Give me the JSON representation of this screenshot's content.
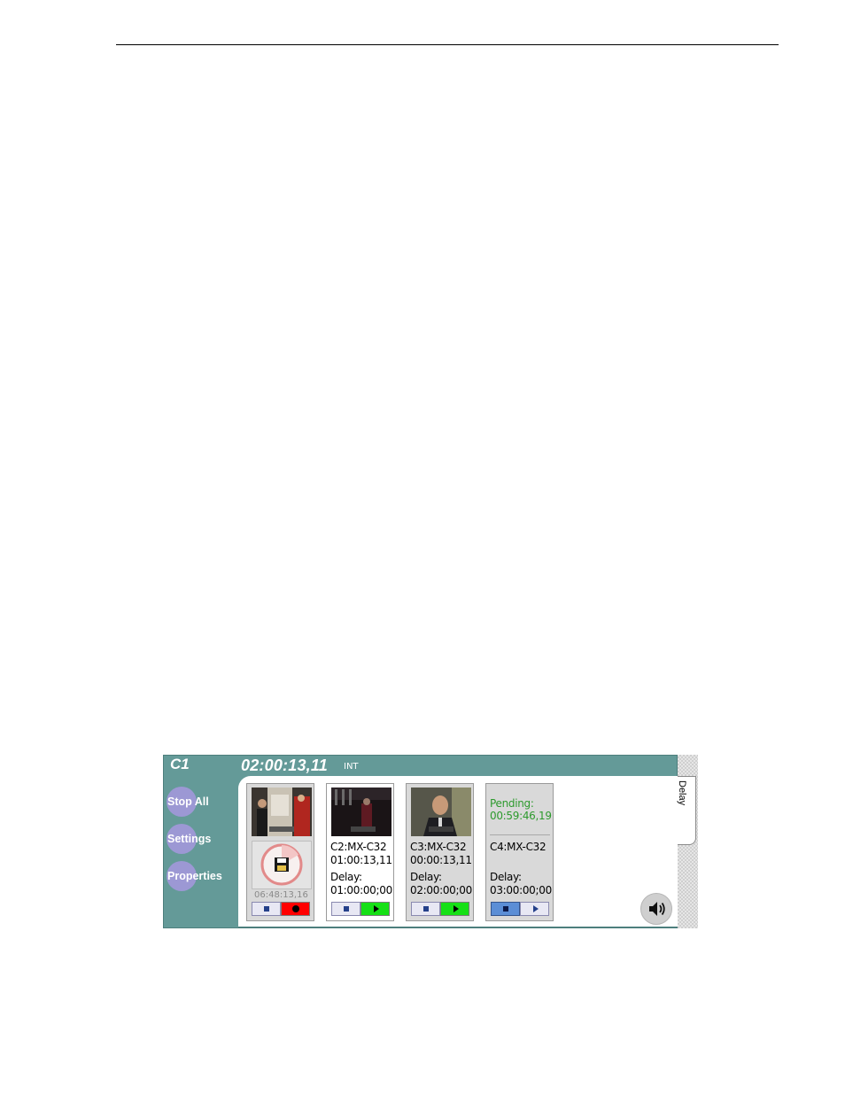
{
  "panel": {
    "channel_name": "C1",
    "timecode": "02:00:13,11",
    "source": "INT"
  },
  "sidebar": {
    "buttons": [
      {
        "label": "Stop All"
      },
      {
        "label": "Settings"
      },
      {
        "label": "Properties"
      }
    ]
  },
  "tab": {
    "label": "Delay"
  },
  "channels": [
    {
      "record_timecode": "06:48:13,16"
    },
    {
      "name": "C2:MX-C32",
      "timecode": "01:00:13,11",
      "delay_label": "Delay:",
      "delay": "01:00:00;00"
    },
    {
      "name": "C3:MX-C32",
      "timecode": "00:00:13,11",
      "delay_label": "Delay:",
      "delay": "02:00:00;00"
    },
    {
      "pending_label": "Pending:",
      "pending": "00:59:46,19",
      "name": "C4:MX-C32",
      "delay_label": "Delay:",
      "delay": "03:00:00;00"
    }
  ],
  "icons": {
    "stop": "stop-icon",
    "record": "record-icon",
    "play": "play-icon",
    "disk": "floppy-disk-icon",
    "speaker": "speaker-icon"
  },
  "colors": {
    "panel": "#649a98",
    "side_button": "#9c98d4",
    "record": "#ff0000",
    "play": "#16e016",
    "pending_text": "#2d9a2d"
  }
}
